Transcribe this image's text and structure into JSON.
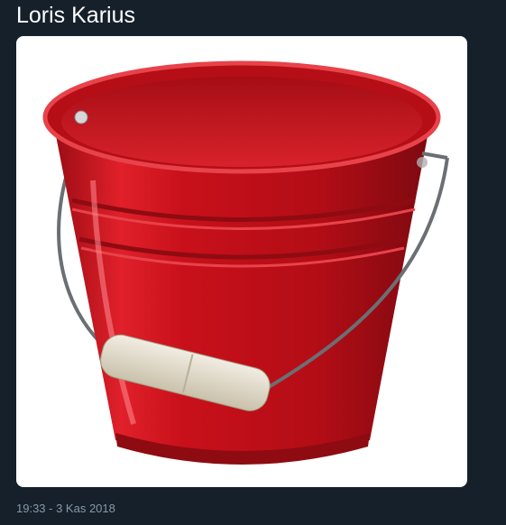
{
  "tweet": {
    "text": "Loris Karius",
    "timestamp": "19:33 - 3 Kas 2018"
  },
  "media": {
    "alt": "red metal bucket with wire handle and wooden grip",
    "colors": {
      "bucket": "#c8101a",
      "bucket_dark": "#8e0b12",
      "grip": "#e2dccb",
      "wire": "#6b6f74"
    }
  },
  "theme": {
    "background": "#15202b",
    "text": "#ffffff",
    "muted": "#8899a6"
  }
}
